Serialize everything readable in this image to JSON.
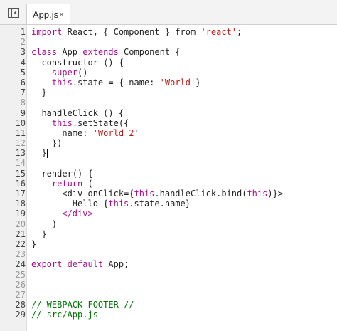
{
  "tab": {
    "label": "App.js",
    "close_glyph": "×",
    "icon": "close-icon"
  },
  "sidebar_toggle_icon": "panel-toggle-icon",
  "colors": {
    "keyword": "#aa0d91",
    "string": "#c41a16",
    "comment": "#007400",
    "text": "#222222",
    "gutter_bg": "#f0f0f0"
  },
  "cursor_line": 13,
  "lines": [
    {
      "n": "1",
      "tokens": [
        [
          "kw",
          "import"
        ],
        [
          "t",
          " React, { Component } from "
        ],
        [
          "str",
          "'react'"
        ],
        [
          "t",
          ";"
        ]
      ]
    },
    {
      "n": "2",
      "tokens": []
    },
    {
      "n": "3",
      "tokens": [
        [
          "kw",
          "class"
        ],
        [
          "t",
          " App "
        ],
        [
          "kw",
          "extends"
        ],
        [
          "t",
          " Component {"
        ]
      ]
    },
    {
      "n": "4",
      "tokens": [
        [
          "t",
          "  constructor () {"
        ]
      ]
    },
    {
      "n": "5",
      "tokens": [
        [
          "t",
          "    "
        ],
        [
          "kw",
          "super"
        ],
        [
          "t",
          "()"
        ]
      ]
    },
    {
      "n": "6",
      "tokens": [
        [
          "t",
          "    "
        ],
        [
          "kw",
          "this"
        ],
        [
          "t",
          ".state = { name: "
        ],
        [
          "str",
          "'World'"
        ],
        [
          "t",
          "}"
        ]
      ]
    },
    {
      "n": "7",
      "tokens": [
        [
          "t",
          "  }"
        ]
      ]
    },
    {
      "n": "8",
      "tokens": []
    },
    {
      "n": "9",
      "tokens": [
        [
          "t",
          "  handleClick () {"
        ]
      ]
    },
    {
      "n": "10",
      "tokens": [
        [
          "t",
          "    "
        ],
        [
          "kw",
          "this"
        ],
        [
          "t",
          ".setState({"
        ]
      ]
    },
    {
      "n": "11",
      "tokens": [
        [
          "t",
          "      name: "
        ],
        [
          "str",
          "'World 2'"
        ]
      ]
    },
    {
      "n": "12",
      "tokens": [
        [
          "t",
          "    })"
        ]
      ]
    },
    {
      "n": "13",
      "tokens": [
        [
          "t",
          "  }"
        ]
      ]
    },
    {
      "n": "14",
      "tokens": []
    },
    {
      "n": "15",
      "tokens": [
        [
          "t",
          "  render() {"
        ]
      ]
    },
    {
      "n": "16",
      "tokens": [
        [
          "t",
          "    "
        ],
        [
          "kw",
          "return"
        ],
        [
          "t",
          " ("
        ]
      ]
    },
    {
      "n": "17",
      "tokens": [
        [
          "t",
          "      <div onClick={"
        ],
        [
          "kw",
          "this"
        ],
        [
          "t",
          ".handleClick.bind("
        ],
        [
          "kw",
          "this"
        ],
        [
          "t",
          ")}>"
        ]
      ]
    },
    {
      "n": "18",
      "tokens": [
        [
          "t",
          "        Hello {"
        ],
        [
          "kw",
          "this"
        ],
        [
          "t",
          ".state.name}"
        ]
      ]
    },
    {
      "n": "19",
      "tokens": [
        [
          "t",
          "      "
        ],
        [
          "tag",
          "</div>"
        ]
      ]
    },
    {
      "n": "20",
      "tokens": [
        [
          "t",
          "    )"
        ]
      ]
    },
    {
      "n": "21",
      "tokens": [
        [
          "t",
          "  }"
        ]
      ]
    },
    {
      "n": "22",
      "tokens": [
        [
          "t",
          "}"
        ]
      ]
    },
    {
      "n": "23",
      "tokens": []
    },
    {
      "n": "24",
      "tokens": [
        [
          "kw",
          "export"
        ],
        [
          "t",
          " "
        ],
        [
          "kw",
          "default"
        ],
        [
          "t",
          " App;"
        ]
      ]
    },
    {
      "n": "25",
      "tokens": []
    },
    {
      "n": "26",
      "tokens": []
    },
    {
      "n": "27",
      "tokens": []
    },
    {
      "n": "28",
      "tokens": [
        [
          "cm",
          "// WEBPACK FOOTER //"
        ]
      ]
    },
    {
      "n": "29",
      "tokens": [
        [
          "cm",
          "// src/App.js"
        ]
      ]
    }
  ],
  "strong_line_numbers": [
    "1",
    "3",
    "4",
    "5",
    "6",
    "7",
    "9",
    "10",
    "11",
    "13",
    "15",
    "16",
    "17",
    "18",
    "19",
    "21",
    "22",
    "24",
    "28",
    "29"
  ]
}
